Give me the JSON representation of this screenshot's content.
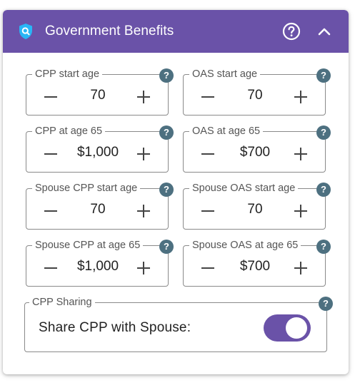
{
  "header": {
    "title": "Government Benefits",
    "icons": [
      "shield-search-icon",
      "help-circle-icon",
      "chevron-up-icon"
    ],
    "background_color": "#6a52a8"
  },
  "fields": {
    "cpp_start_age": {
      "label": "CPP start age",
      "value": "70"
    },
    "oas_start_age": {
      "label": "OAS start age",
      "value": "70"
    },
    "cpp_at_65": {
      "label": "CPP at age 65",
      "value": "$1,000"
    },
    "oas_at_65": {
      "label": "OAS at age 65",
      "value": "$700"
    },
    "spouse_cpp_start_age": {
      "label": "Spouse CPP start age",
      "value": "70"
    },
    "spouse_oas_start_age": {
      "label": "Spouse OAS start age",
      "value": "70"
    },
    "spouse_cpp_at_65": {
      "label": "Spouse CPP at age 65",
      "value": "$1,000"
    },
    "spouse_oas_at_65": {
      "label": "Spouse OAS at age 65",
      "value": "$700"
    }
  },
  "help_badge": "?",
  "cpp_sharing": {
    "legend": "CPP Sharing",
    "label": "Share CPP with Spouse:",
    "enabled": true,
    "accent_color": "#6a52a8"
  }
}
